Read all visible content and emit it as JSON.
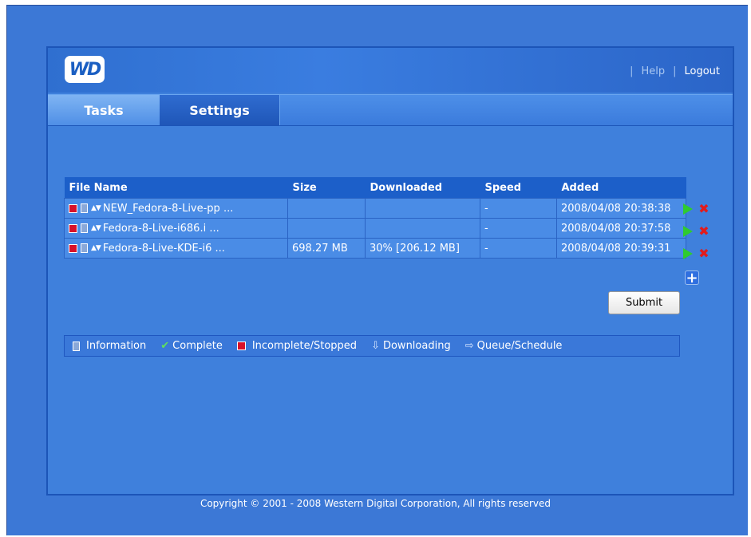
{
  "header": {
    "logo_text": "WD",
    "help_label": "Help",
    "logout_label": "Logout"
  },
  "tabs": [
    {
      "label": "Tasks",
      "active": true
    },
    {
      "label": "Settings",
      "active": false
    }
  ],
  "table": {
    "columns": [
      "File Name",
      "Size",
      "Downloaded",
      "Speed",
      "Added"
    ],
    "rows": [
      {
        "name": "NEW_Fedora-8-Live-pp ...",
        "size": "",
        "downloaded": "",
        "speed": "-",
        "added": "2008/04/08 20:38:38"
      },
      {
        "name": "Fedora-8-Live-i686.i ...",
        "size": "",
        "downloaded": "",
        "speed": "-",
        "added": "2008/04/08 20:37:58"
      },
      {
        "name": "Fedora-8-Live-KDE-i6 ...",
        "size": "698.27 MB",
        "downloaded": "30% [206.12 MB]",
        "speed": "-",
        "added": "2008/04/08 20:39:31"
      }
    ]
  },
  "submit_label": "Submit",
  "legend": {
    "information": "Information",
    "complete": "Complete",
    "incomplete": "Incomplete/Stopped",
    "downloading": "Downloading",
    "queue": "Queue/Schedule"
  },
  "footer": "Copyright © 2001 - 2008 Western Digital Corporation, All rights reserved",
  "icons": [
    "info-icon",
    "check-icon",
    "stop-icon",
    "download-icon",
    "queue-icon",
    "play-icon",
    "delete-icon",
    "add-icon",
    "sort-arrows-icon"
  ],
  "colors": {
    "background": "#3c78d6",
    "header": "#2f6fd0",
    "table_header": "#1c5fc9",
    "stop": "#d8112a",
    "play": "#2fcb2f",
    "delete": "#e21b1b"
  }
}
